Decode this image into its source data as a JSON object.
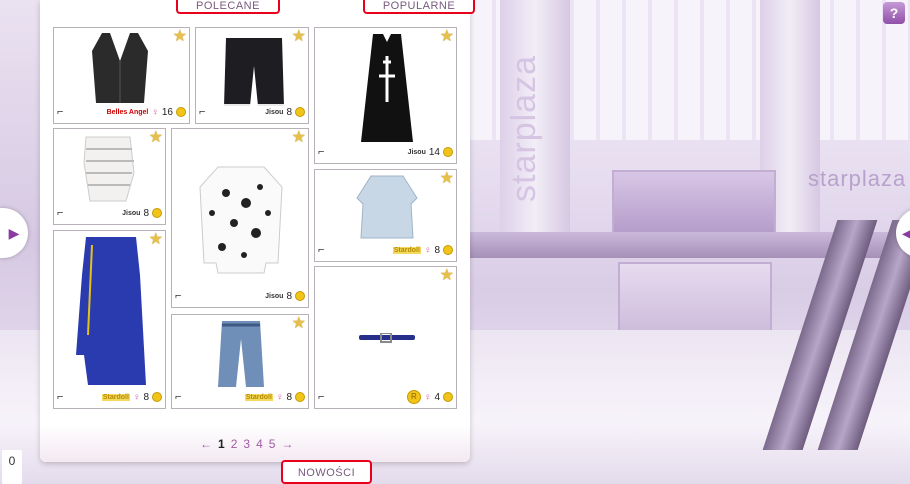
{
  "tabs": {
    "recommended": "POLECANE",
    "popular": "POPULARNE",
    "new": "NOWOŚCI"
  },
  "background": {
    "brand_vertical": "starplaza",
    "brand_horizontal": "starplaza"
  },
  "items": [
    {
      "brand": "Belles Angel",
      "gender": "♀",
      "price": "16",
      "item": "black vest"
    },
    {
      "brand": "Jisou",
      "gender": "",
      "price": "8",
      "item": "black shorts"
    },
    {
      "brand": "Jisou",
      "gender": "",
      "price": "14",
      "item": "black dress"
    },
    {
      "brand": "Jisou",
      "gender": "",
      "price": "8",
      "item": "striped top"
    },
    {
      "brand": "Jisou",
      "gender": "",
      "price": "8",
      "item": "print blouse"
    },
    {
      "brand": "Stardoll",
      "gender": "♀",
      "price": "8",
      "item": "blue tunic"
    },
    {
      "brand": "Stardoll",
      "gender": "♀",
      "price": "8",
      "item": "blue dress"
    },
    {
      "brand": "Stardoll",
      "gender": "♀",
      "price": "8",
      "item": "jeans"
    },
    {
      "brand": "R",
      "gender": "♀",
      "price": "4",
      "item": "belt"
    }
  ],
  "pagination": {
    "prev": "←",
    "pages": [
      "1",
      "2",
      "3",
      "4",
      "5"
    ],
    "next": "→"
  },
  "counter": "0",
  "help_label": "?"
}
